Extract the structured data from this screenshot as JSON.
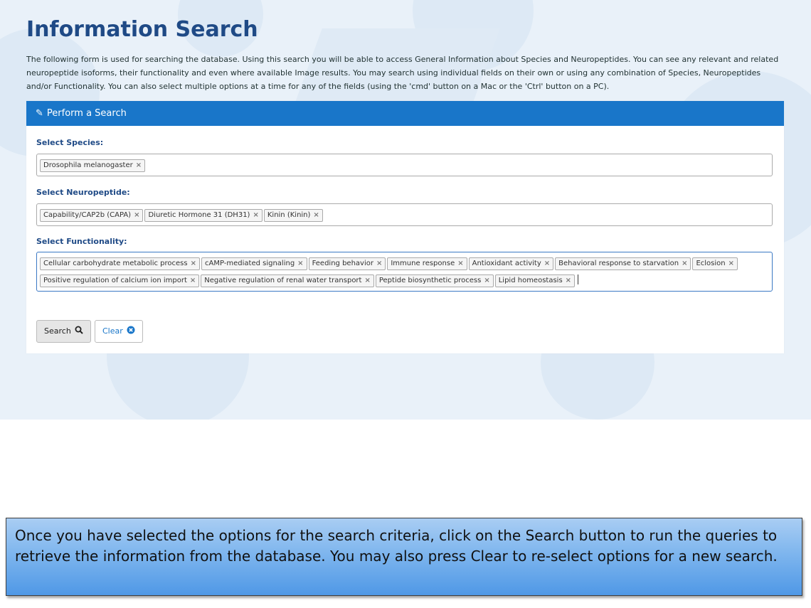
{
  "page": {
    "title": "Information Search",
    "intro": "The following form is used for searching the database. Using this search you will be able to access General Information about Species and Neuropeptides. You can see any relevant and related neuropeptide isoforms, their functionality and even where available Image results. You may search using individual fields on their own or using any combination of Species, Neuropeptides and/or Functionality. You can also select multiple options at a time for any of the fields (using the 'cmd' button on a Mac or the 'Ctrl' button on a PC)."
  },
  "panel": {
    "heading": "Perform a Search",
    "heading_icon": "edit-icon"
  },
  "species": {
    "label": "Select Species:",
    "selected": [
      "Drosophila melanogaster"
    ]
  },
  "neuropeptide": {
    "label": "Select Neuropeptide:",
    "selected": [
      "Capability/CAP2b (CAPA)",
      "Diuretic Hormone 31 (DH31)",
      "Kinin (Kinin)"
    ]
  },
  "functionality": {
    "label": "Select Functionality:",
    "selected": [
      "Cellular carbohydrate metabolic process",
      "cAMP-mediated signaling",
      "Feeding behavior",
      "Immune response",
      "Antioxidant activity",
      "Behavioral response to starvation",
      "Eclosion",
      "Positive regulation of calcium ion import",
      "Negative regulation of renal water transport",
      "Peptide biosynthetic process",
      "Lipid homeostasis"
    ]
  },
  "buttons": {
    "search_label": "Search",
    "search_icon": "search-icon",
    "clear_label": "Clear",
    "clear_icon": "clear-circle-icon"
  },
  "tag_remove_glyph": "×",
  "callout": {
    "text": "Once you have selected the options for the search criteria, click on the Search button to run the queries to retrieve the information from the database. You may also press Clear to re-select options for a new search."
  },
  "colors": {
    "primary": "#1976c9",
    "heading": "#1f4a86",
    "background": "#e9f1f9",
    "callout": "#4f98e6"
  }
}
